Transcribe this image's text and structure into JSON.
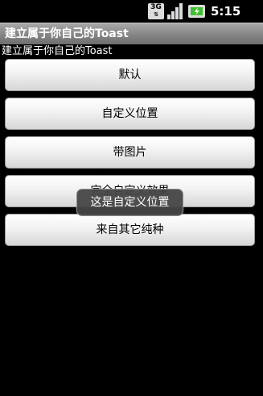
{
  "status_bar": {
    "network": "3G",
    "time": "5:15 AM",
    "icons": [
      "network-3g-icon",
      "signal-icon",
      "battery-charging-icon"
    ]
  },
  "title_bar": {
    "title": "建立属于你自己的Toast"
  },
  "content": {
    "label": "建立属于你自己的Toast"
  },
  "buttons": [
    {
      "label": "默认"
    },
    {
      "label": "自定义位置"
    },
    {
      "label": "带图片"
    },
    {
      "label": "完全自定义效果"
    },
    {
      "label": "来自其它纯种"
    }
  ],
  "toast": {
    "message": "这是自定义位置"
  },
  "colors": {
    "background": "#000000",
    "title_bar": "#8a8a8a",
    "button_face": "#f2f2f2",
    "toast_bg": "#464646",
    "battery_accent": "#3fbf2f"
  }
}
